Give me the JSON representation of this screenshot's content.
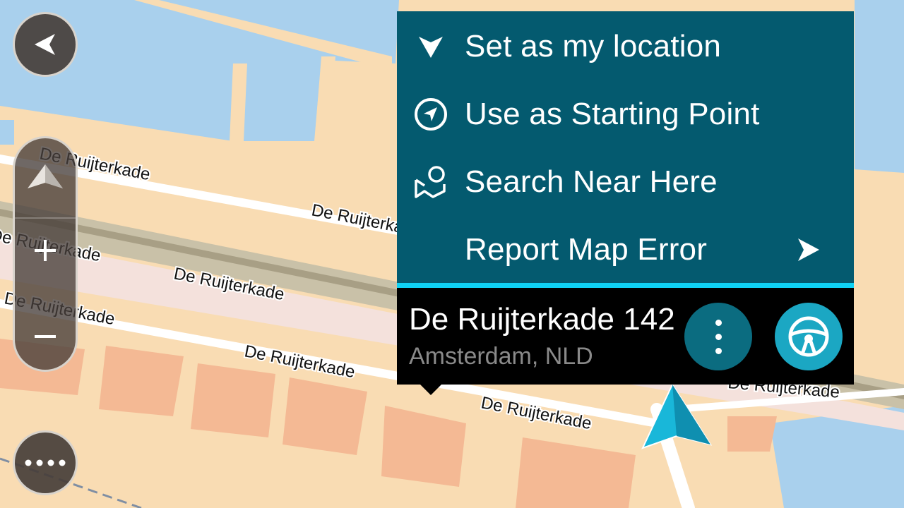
{
  "map": {
    "street_labels": [
      "De Ruijterkade",
      "De Ruijterkade",
      "De Ruijterkade",
      "De Ruijterkade",
      "De Ruijterkade",
      "De Ruijterkade",
      "De Ruijterkade",
      "De Ruijterkade"
    ],
    "colors": {
      "water": "#a9d0ed",
      "land": "#f9dcb3",
      "building": "#f4b994",
      "road": "#ffffff",
      "rail": "#b6af95",
      "route_marker": "#19b7d9"
    }
  },
  "controls": {
    "back_icon": "back-arrow-icon",
    "compass_icon": "compass-arrow-icon",
    "zoom_in_icon": "plus-icon",
    "zoom_out_icon": "minus-icon",
    "more_icon": "more-dots-icon"
  },
  "popup": {
    "menu": [
      {
        "label": "Set as my location",
        "icon": "location-marker-icon"
      },
      {
        "label": "Use as Starting Point",
        "icon": "starting-point-icon"
      },
      {
        "label": "Search Near Here",
        "icon": "search-near-icon"
      },
      {
        "label": "Report Map Error",
        "icon": "",
        "arrow": "chevron-right-icon"
      }
    ],
    "address": "De Ruijterkade 142",
    "city": "Amsterdam, NLD",
    "options_icon": "vertical-dots-icon",
    "drive_icon": "steering-wheel-icon",
    "colors": {
      "menu_bg": "#045a6f",
      "divider": "#0fd2f5",
      "panel_bg": "#000000",
      "drive_btn": "#1ba7c3",
      "options_btn": "#0b6c80"
    }
  }
}
